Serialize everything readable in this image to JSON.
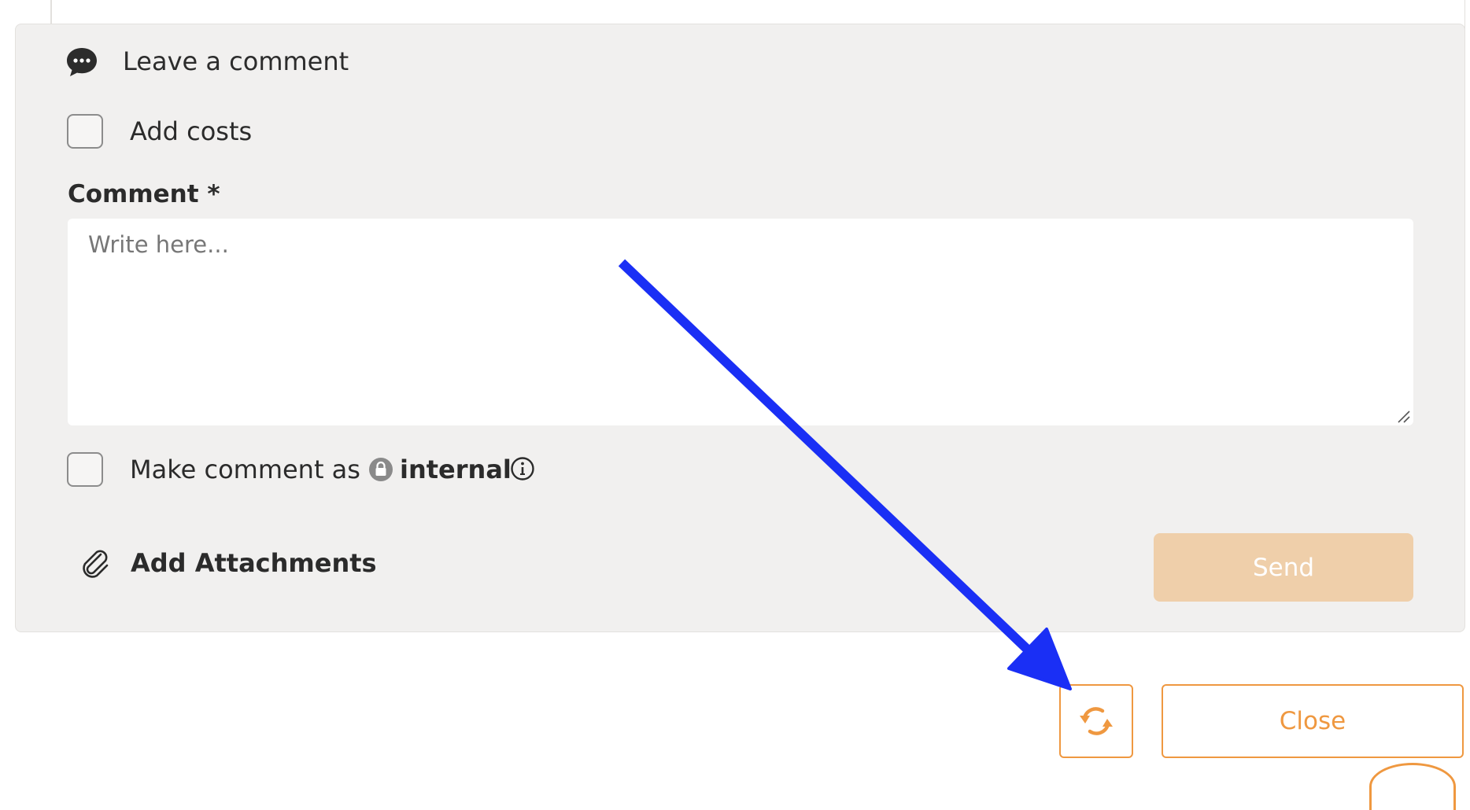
{
  "form": {
    "heading": "Leave a comment",
    "add_costs_label": "Add costs",
    "add_costs_checked": false,
    "comment_label": "Comment *",
    "comment_placeholder": "Write here...",
    "comment_value": "",
    "make_comment_as_label": "Make comment as",
    "internal_label": "internal",
    "internal_checked": false,
    "add_attachments_label": "Add Attachments",
    "send_label": "Send"
  },
  "footer": {
    "close_label": "Close"
  },
  "icons": {
    "heading": "chat-bubble-icon",
    "internal": "lock-icon",
    "info": "info-icon",
    "attachments": "paperclip-icon",
    "refresh": "refresh-icon",
    "resize": "resize-grip-icon"
  },
  "colors": {
    "accent": "#ef9840",
    "send_disabled": "#efcfaa",
    "panel_background": "#f1f0ef",
    "annotation_arrow": "#1a2ff5"
  }
}
